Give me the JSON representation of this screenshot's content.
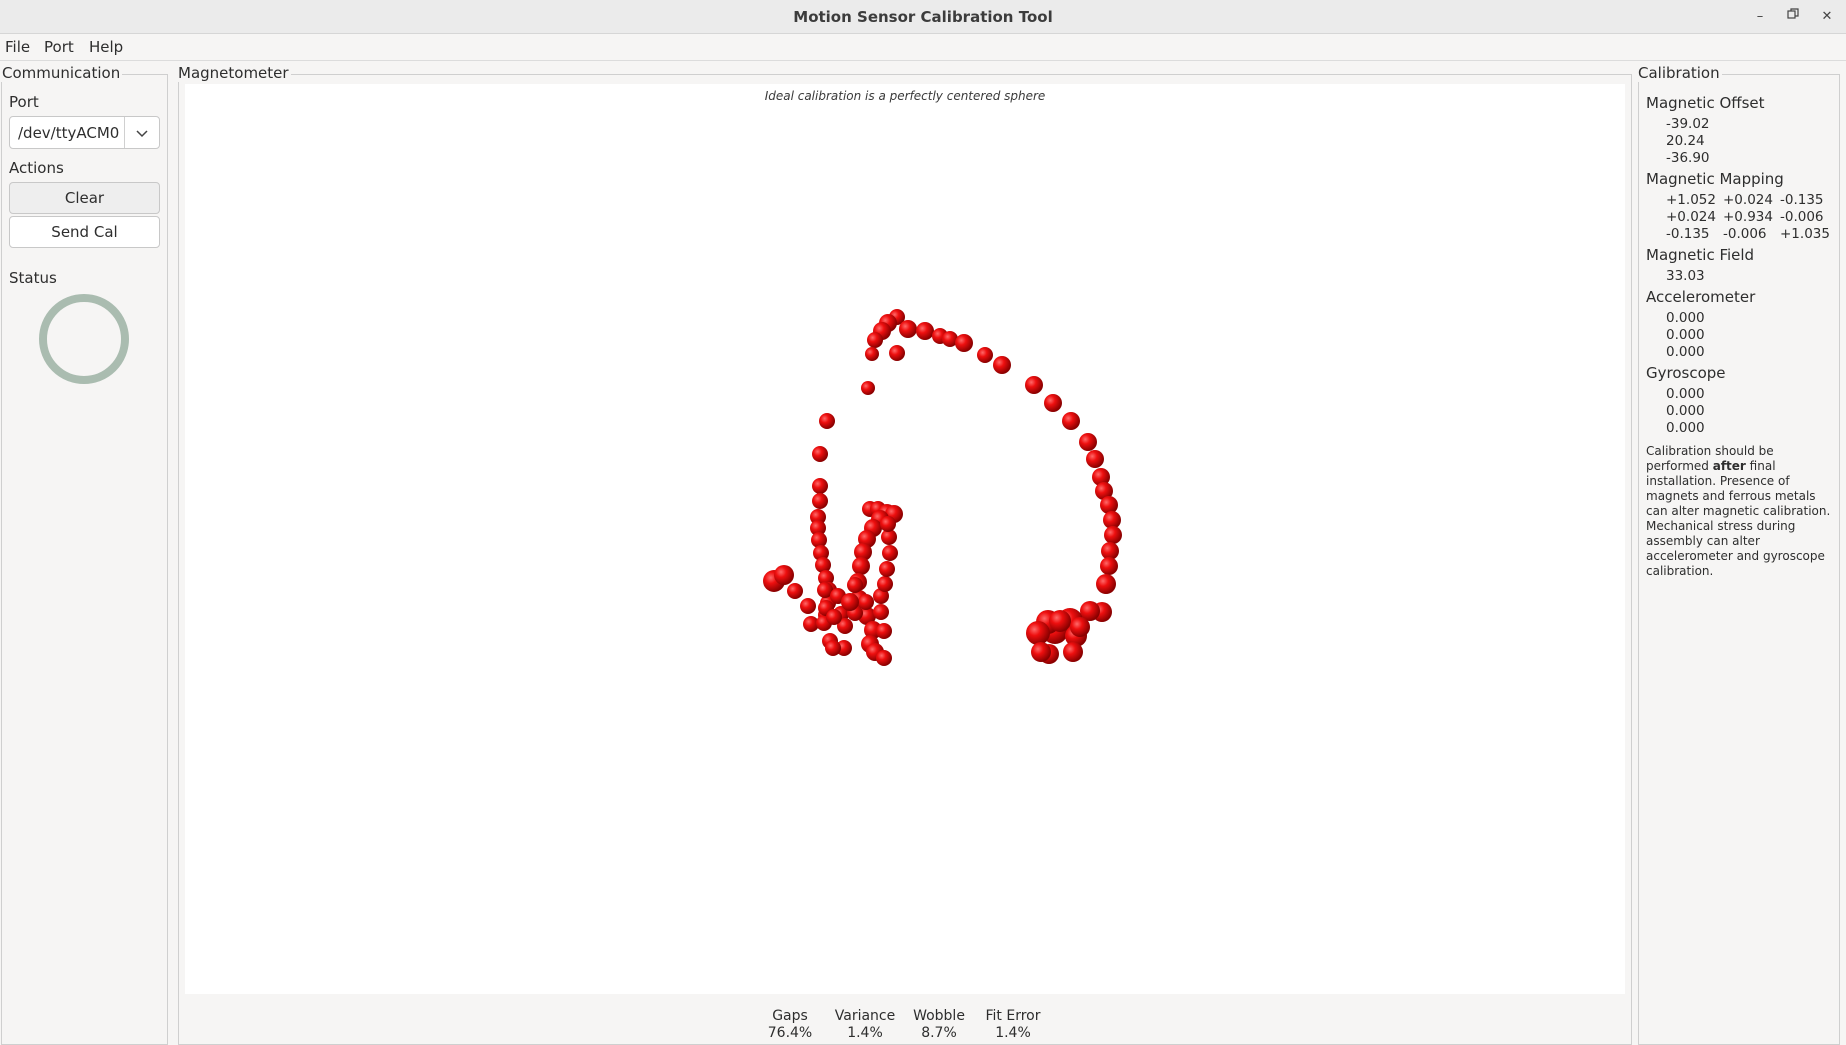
{
  "window": {
    "title": "Motion Sensor Calibration Tool",
    "controls": [
      "minimize",
      "restore",
      "close"
    ]
  },
  "menu": [
    "File",
    "Port",
    "Help"
  ],
  "communication": {
    "group_title": "Communication",
    "port_label": "Port",
    "port_value": "/dev/ttyACM0",
    "actions_label": "Actions",
    "clear_label": "Clear",
    "send_cal_label": "Send Cal",
    "status_label": "Status"
  },
  "magnetometer": {
    "group_title": "Magnetometer",
    "caption": "Ideal calibration is a perfectly centered sphere",
    "point_color": "#e00000",
    "metrics": [
      {
        "label": "Gaps",
        "value": "76.4%"
      },
      {
        "label": "Variance",
        "value": "1.4%"
      },
      {
        "label": "Wobble",
        "value": "8.7%"
      },
      {
        "label": "Fit Error",
        "value": "1.4%"
      }
    ]
  },
  "calibration": {
    "group_title": "Calibration",
    "magnetic_offset_label": "Magnetic Offset",
    "magnetic_offset": [
      "-39.02",
      "20.24",
      "-36.90"
    ],
    "magnetic_mapping_label": "Magnetic Mapping",
    "magnetic_mapping": [
      [
        "+1.052",
        "+0.024",
        "-0.135"
      ],
      [
        "+0.024",
        "+0.934",
        "-0.006"
      ],
      [
        "-0.135",
        "-0.006",
        "+1.035"
      ]
    ],
    "magnetic_field_label": "Magnetic Field",
    "magnetic_field": "33.03",
    "accelerometer_label": "Accelerometer",
    "accelerometer": [
      "0.000",
      "0.000",
      "0.000"
    ],
    "gyroscope_label": "Gyroscope",
    "gyroscope": [
      "0.000",
      "0.000",
      "0.000"
    ],
    "note_pre": "Calibration should be performed ",
    "note_bold": "after",
    "note_post": " final installation.  Presence of magnets and ferrous metals can alter magnetic calibration. Mechanical stress during assembly can alter accelerometer and gyroscope calibration."
  }
}
